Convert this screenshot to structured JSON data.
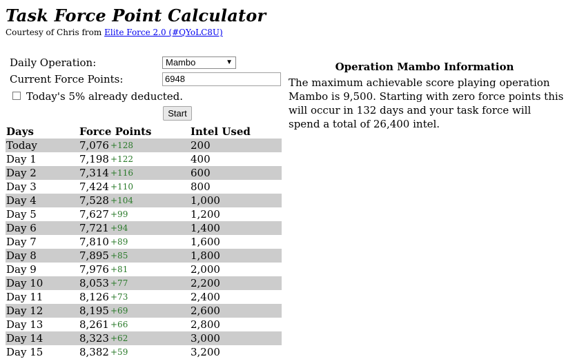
{
  "title": "Task Force Point Calculator",
  "courtesy": {
    "prefix": "Courtesy of Chris from ",
    "link": "Elite Force 2.0 (#QYoLC8U)"
  },
  "form": {
    "operation_label": "Daily Operation:",
    "operation_value": "Mambo",
    "points_label": "Current Force Points:",
    "points_value": "6948",
    "deducted_label": "Today's 5% already deducted.",
    "deducted_checked": false,
    "start_label": "Start"
  },
  "info": {
    "heading": "Operation Mambo Information",
    "text": "The maximum achievable score playing operation Mambo is 9,500. Starting with zero force points this will occur in 132 days and your task force will spend a total of 26,400 intel."
  },
  "table": {
    "headers": {
      "day": "Days",
      "points": "Force Points",
      "intel": "Intel Used"
    },
    "rows": [
      {
        "day": "Today",
        "points": "7,076",
        "delta": "+128",
        "intel": "200"
      },
      {
        "day": "Day 1",
        "points": "7,198",
        "delta": "+122",
        "intel": "400"
      },
      {
        "day": "Day 2",
        "points": "7,314",
        "delta": "+116",
        "intel": "600"
      },
      {
        "day": "Day 3",
        "points": "7,424",
        "delta": "+110",
        "intel": "800"
      },
      {
        "day": "Day 4",
        "points": "7,528",
        "delta": "+104",
        "intel": "1,000"
      },
      {
        "day": "Day 5",
        "points": "7,627",
        "delta": "+99",
        "intel": "1,200"
      },
      {
        "day": "Day 6",
        "points": "7,721",
        "delta": "+94",
        "intel": "1,400"
      },
      {
        "day": "Day 7",
        "points": "7,810",
        "delta": "+89",
        "intel": "1,600"
      },
      {
        "day": "Day 8",
        "points": "7,895",
        "delta": "+85",
        "intel": "1,800"
      },
      {
        "day": "Day 9",
        "points": "7,976",
        "delta": "+81",
        "intel": "2,000"
      },
      {
        "day": "Day 10",
        "points": "8,053",
        "delta": "+77",
        "intel": "2,200"
      },
      {
        "day": "Day 11",
        "points": "8,126",
        "delta": "+73",
        "intel": "2,400"
      },
      {
        "day": "Day 12",
        "points": "8,195",
        "delta": "+69",
        "intel": "2,600"
      },
      {
        "day": "Day 13",
        "points": "8,261",
        "delta": "+66",
        "intel": "2,800"
      },
      {
        "day": "Day 14",
        "points": "8,323",
        "delta": "+62",
        "intel": "3,000"
      },
      {
        "day": "Day 15",
        "points": "8,382",
        "delta": "+59",
        "intel": "3,200"
      }
    ]
  },
  "colors": {
    "alt_row": "#cccccc",
    "delta": "#2a7a2a",
    "link": "#0000ee"
  }
}
